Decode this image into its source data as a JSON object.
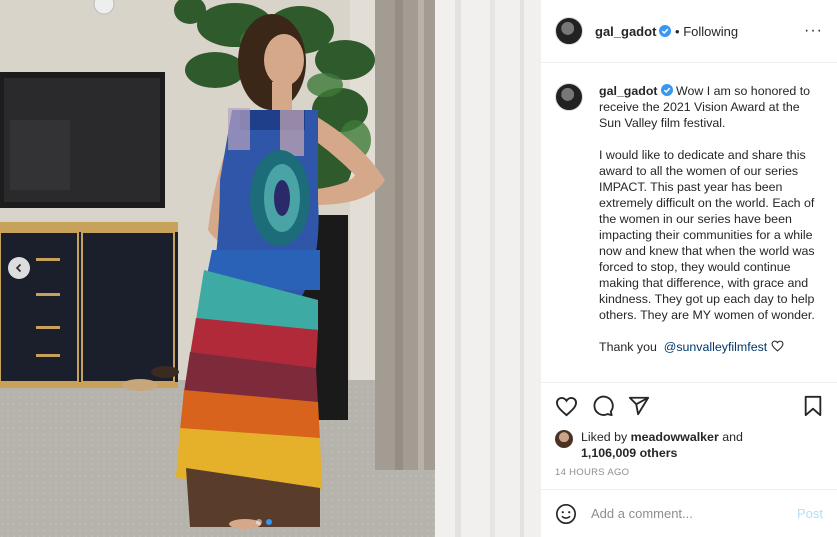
{
  "post": {
    "username": "gal_gadot",
    "follow_status": "Following",
    "separator": "•"
  },
  "caption": {
    "username": "gal_gadot",
    "paragraphs": [
      "Wow I am so honored to receive the 2021 Vision Award at the Sun Valley film festival.",
      "I would like to dedicate and share this award to all the women of our series IMPACT. This past year has been extremely difficult on the world. Each of the women in our series have been impacting their communities for a while now and knew that when the world was forced to stop, they would continue making that difference, with grace and kindness. They got up each day to help others. They are MY women of wonder."
    ],
    "closing": "Thank you",
    "mention": "@sunvalleyfilmfest",
    "closing_icon": "heart-outline-icon"
  },
  "likes": {
    "prefix": "Liked by",
    "user": "meadowwalker",
    "joiner": "and",
    "count": "1,106,009 others"
  },
  "timestamp": "14 HOURS AGO",
  "comment": {
    "placeholder": "Add a comment...",
    "post_label": "Post"
  },
  "carousel": {
    "current": 1,
    "total": 2
  },
  "icons": {
    "more": "more-options-icon",
    "like": "heart-icon",
    "comment": "comment-icon",
    "share": "share-icon",
    "save": "bookmark-icon",
    "emoji": "emoji-icon",
    "verified": "verified-badge-icon",
    "prev": "chevron-left-icon"
  },
  "colors": {
    "verified": "#3897f0",
    "link": "#00376b",
    "post_disabled": "#b2dffc",
    "muted": "#8e8e8e",
    "active_dot": "#3897f0"
  }
}
